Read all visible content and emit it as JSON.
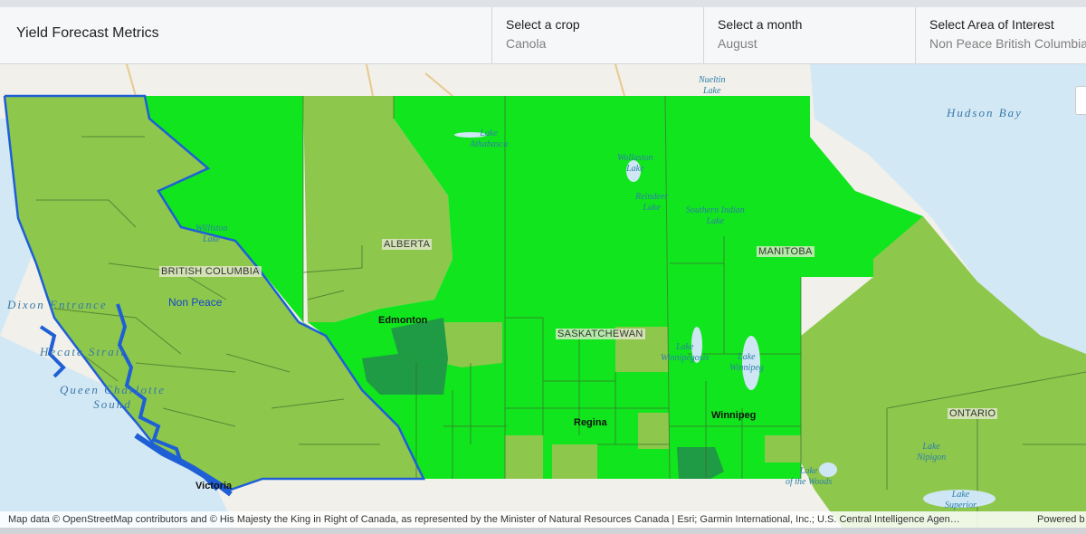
{
  "header": {
    "title": "Yield Forecast Metrics",
    "crop": {
      "label": "Select a crop",
      "value": "Canola"
    },
    "month": {
      "label": "Select a month",
      "value": "August"
    },
    "area": {
      "label": "Select Area of Interest",
      "value": "Non Peace British Columbia"
    }
  },
  "map": {
    "provinces": {
      "bc": "BRITISH COLUMBIA",
      "ab": "ALBERTA",
      "sk": "SASKATCHEWAN",
      "mb": "MANITOBA",
      "on": "ONTARIO"
    },
    "cities": {
      "edmonton": "Edmonton",
      "regina": "Regina",
      "winnipeg": "Winnipeg",
      "victoria": "Victoria"
    },
    "region_label": "Non Peace",
    "water": {
      "nueltin": [
        "Nueltin",
        "Lake"
      ],
      "hudson": "Hudson Bay",
      "athabasca": [
        "Lake",
        "Athabasca"
      ],
      "wollaston": [
        "Wollaston",
        "Lake"
      ],
      "reindeer": [
        "Reindeer",
        "Lake"
      ],
      "southern_indian": [
        "Southern Indian",
        "Lake"
      ],
      "williston": [
        "Williston",
        "Lake"
      ],
      "dixon": "Dixon Entrance",
      "hecate": "Hecate Strait",
      "queen_charlotte": [
        "Queen Charlotte",
        "Sound"
      ],
      "winnipegosis": [
        "Lake",
        "Winnipegosis"
      ],
      "winnipeg_lake": [
        "Lake",
        "Winnipeg"
      ],
      "woods": [
        "Lake",
        "of the Woods"
      ],
      "nipigon": [
        "Lake",
        "Nipigon"
      ],
      "superior": [
        "Lake",
        "Superior"
      ]
    },
    "colors": {
      "baseline": "#8dc84c",
      "above": "#11e51d",
      "high": "#1f9a45",
      "boundary": "#1f5fd6",
      "water": "#cfe6f4"
    }
  },
  "attribution": {
    "text": "Map data © OpenStreetMap contributors and © His Majesty the King in Right of Canada, as represented by the Minister of Natural Resources Canada | Esri; Garmin International, Inc.; U.S. Central Intelligence Agen…",
    "powered": "Powered b"
  }
}
